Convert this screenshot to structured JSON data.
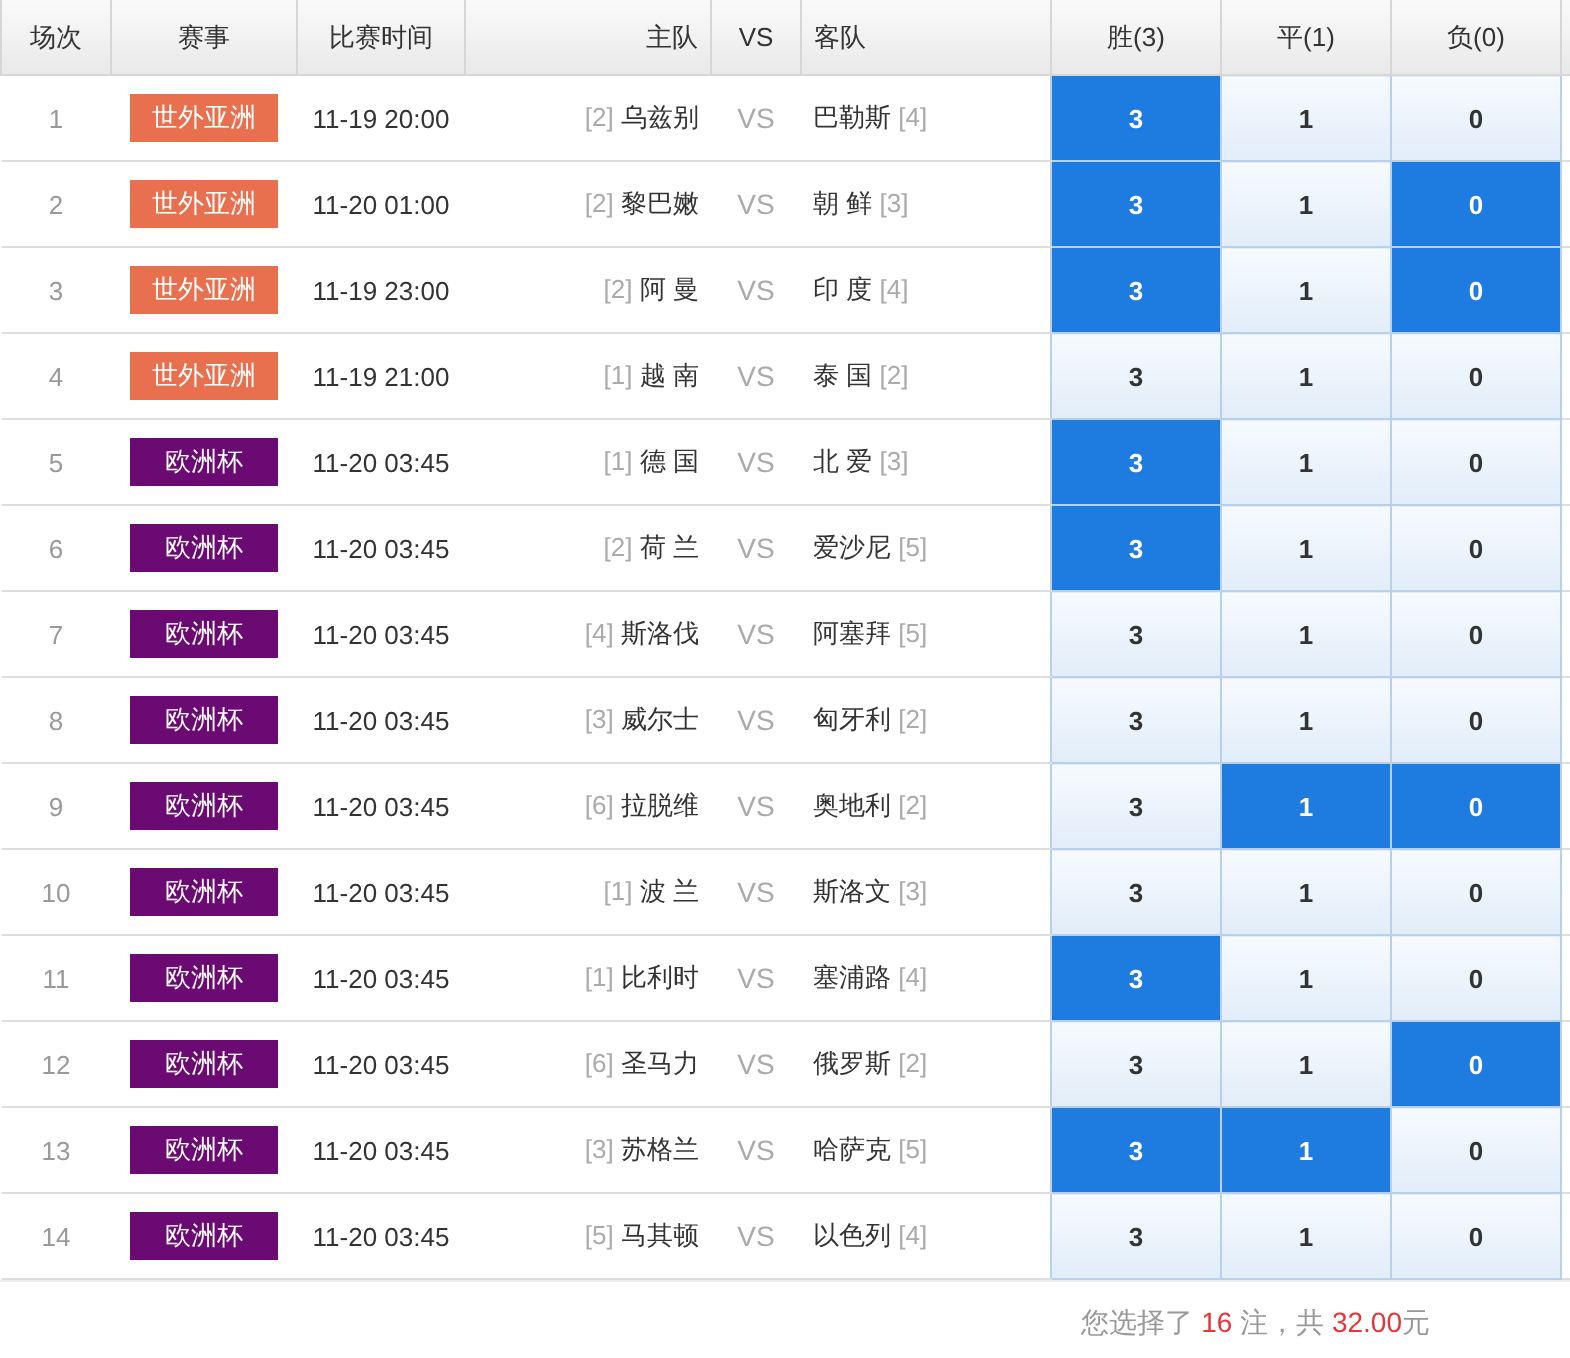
{
  "columns": [
    {
      "label": "场次"
    },
    {
      "label": "赛事"
    },
    {
      "label": "比赛时间"
    },
    {
      "label": "主队"
    },
    {
      "label": "VS"
    },
    {
      "label": "客队"
    },
    {
      "label": "胜(3)"
    },
    {
      "label": "平(1)"
    },
    {
      "label": "负(0)"
    }
  ],
  "matches": [
    {
      "no": "1",
      "league": {
        "name": "世外亚洲",
        "color": "#e8704f"
      },
      "time": "11-19 20:00",
      "home_rank": "[2]",
      "home": "乌兹别",
      "vs": "VS",
      "away": "巴勒斯",
      "away_rank": "[4]",
      "odds": [
        {
          "value": "3",
          "selected": true
        },
        {
          "value": "1",
          "selected": false
        },
        {
          "value": "0",
          "selected": false
        }
      ]
    },
    {
      "no": "2",
      "league": {
        "name": "世外亚洲",
        "color": "#e8704f"
      },
      "time": "11-20 01:00",
      "home_rank": "[2]",
      "home": "黎巴嫩",
      "vs": "VS",
      "away": "朝 鲜",
      "away_rank": "[3]",
      "odds": [
        {
          "value": "3",
          "selected": true
        },
        {
          "value": "1",
          "selected": false
        },
        {
          "value": "0",
          "selected": true
        }
      ]
    },
    {
      "no": "3",
      "league": {
        "name": "世外亚洲",
        "color": "#e8704f"
      },
      "time": "11-19 23:00",
      "home_rank": "[2]",
      "home": "阿 曼",
      "vs": "VS",
      "away": "印 度",
      "away_rank": "[4]",
      "odds": [
        {
          "value": "3",
          "selected": true
        },
        {
          "value": "1",
          "selected": false
        },
        {
          "value": "0",
          "selected": true
        }
      ]
    },
    {
      "no": "4",
      "league": {
        "name": "世外亚洲",
        "color": "#e8704f"
      },
      "time": "11-19 21:00",
      "home_rank": "[1]",
      "home": "越 南",
      "vs": "VS",
      "away": "泰 国",
      "away_rank": "[2]",
      "odds": [
        {
          "value": "3",
          "selected": false
        },
        {
          "value": "1",
          "selected": false
        },
        {
          "value": "0",
          "selected": false
        }
      ]
    },
    {
      "no": "5",
      "league": {
        "name": "欧洲杯",
        "color": "#6a0a72"
      },
      "time": "11-20 03:45",
      "home_rank": "[1]",
      "home": "德 国",
      "vs": "VS",
      "away": "北 爱",
      "away_rank": "[3]",
      "odds": [
        {
          "value": "3",
          "selected": true
        },
        {
          "value": "1",
          "selected": false
        },
        {
          "value": "0",
          "selected": false
        }
      ]
    },
    {
      "no": "6",
      "league": {
        "name": "欧洲杯",
        "color": "#6a0a72"
      },
      "time": "11-20 03:45",
      "home_rank": "[2]",
      "home": "荷 兰",
      "vs": "VS",
      "away": "爱沙尼",
      "away_rank": "[5]",
      "odds": [
        {
          "value": "3",
          "selected": true
        },
        {
          "value": "1",
          "selected": false
        },
        {
          "value": "0",
          "selected": false
        }
      ]
    },
    {
      "no": "7",
      "league": {
        "name": "欧洲杯",
        "color": "#6a0a72"
      },
      "time": "11-20 03:45",
      "home_rank": "[4]",
      "home": "斯洛伐",
      "vs": "VS",
      "away": "阿塞拜",
      "away_rank": "[5]",
      "odds": [
        {
          "value": "3",
          "selected": false
        },
        {
          "value": "1",
          "selected": false
        },
        {
          "value": "0",
          "selected": false
        }
      ]
    },
    {
      "no": "8",
      "league": {
        "name": "欧洲杯",
        "color": "#6a0a72"
      },
      "time": "11-20 03:45",
      "home_rank": "[3]",
      "home": "威尔士",
      "vs": "VS",
      "away": "匈牙利",
      "away_rank": "[2]",
      "odds": [
        {
          "value": "3",
          "selected": false
        },
        {
          "value": "1",
          "selected": false
        },
        {
          "value": "0",
          "selected": false
        }
      ]
    },
    {
      "no": "9",
      "league": {
        "name": "欧洲杯",
        "color": "#6a0a72"
      },
      "time": "11-20 03:45",
      "home_rank": "[6]",
      "home": "拉脱维",
      "vs": "VS",
      "away": "奥地利",
      "away_rank": "[2]",
      "odds": [
        {
          "value": "3",
          "selected": false
        },
        {
          "value": "1",
          "selected": true
        },
        {
          "value": "0",
          "selected": true
        }
      ]
    },
    {
      "no": "10",
      "league": {
        "name": "欧洲杯",
        "color": "#6a0a72"
      },
      "time": "11-20 03:45",
      "home_rank": "[1]",
      "home": "波 兰",
      "vs": "VS",
      "away": "斯洛文",
      "away_rank": "[3]",
      "odds": [
        {
          "value": "3",
          "selected": false
        },
        {
          "value": "1",
          "selected": false
        },
        {
          "value": "0",
          "selected": false
        }
      ]
    },
    {
      "no": "11",
      "league": {
        "name": "欧洲杯",
        "color": "#6a0a72"
      },
      "time": "11-20 03:45",
      "home_rank": "[1]",
      "home": "比利时",
      "vs": "VS",
      "away": "塞浦路",
      "away_rank": "[4]",
      "odds": [
        {
          "value": "3",
          "selected": true
        },
        {
          "value": "1",
          "selected": false
        },
        {
          "value": "0",
          "selected": false
        }
      ]
    },
    {
      "no": "12",
      "league": {
        "name": "欧洲杯",
        "color": "#6a0a72"
      },
      "time": "11-20 03:45",
      "home_rank": "[6]",
      "home": "圣马力",
      "vs": "VS",
      "away": "俄罗斯",
      "away_rank": "[2]",
      "odds": [
        {
          "value": "3",
          "selected": false
        },
        {
          "value": "1",
          "selected": false
        },
        {
          "value": "0",
          "selected": true
        }
      ]
    },
    {
      "no": "13",
      "league": {
        "name": "欧洲杯",
        "color": "#6a0a72"
      },
      "time": "11-20 03:45",
      "home_rank": "[3]",
      "home": "苏格兰",
      "vs": "VS",
      "away": "哈萨克",
      "away_rank": "[5]",
      "odds": [
        {
          "value": "3",
          "selected": true
        },
        {
          "value": "1",
          "selected": true
        },
        {
          "value": "0",
          "selected": false
        }
      ]
    },
    {
      "no": "14",
      "league": {
        "name": "欧洲杯",
        "color": "#6a0a72"
      },
      "time": "11-20 03:45",
      "home_rank": "[5]",
      "home": "马其顿",
      "vs": "VS",
      "away": "以色列",
      "away_rank": "[4]",
      "odds": [
        {
          "value": "3",
          "selected": false
        },
        {
          "value": "1",
          "selected": false
        },
        {
          "value": "0",
          "selected": false
        }
      ]
    }
  ],
  "summary": {
    "prefix": "您选择了 ",
    "count": "16",
    "middle": " 注，共 ",
    "amount": "32.00",
    "suffix": "元"
  }
}
